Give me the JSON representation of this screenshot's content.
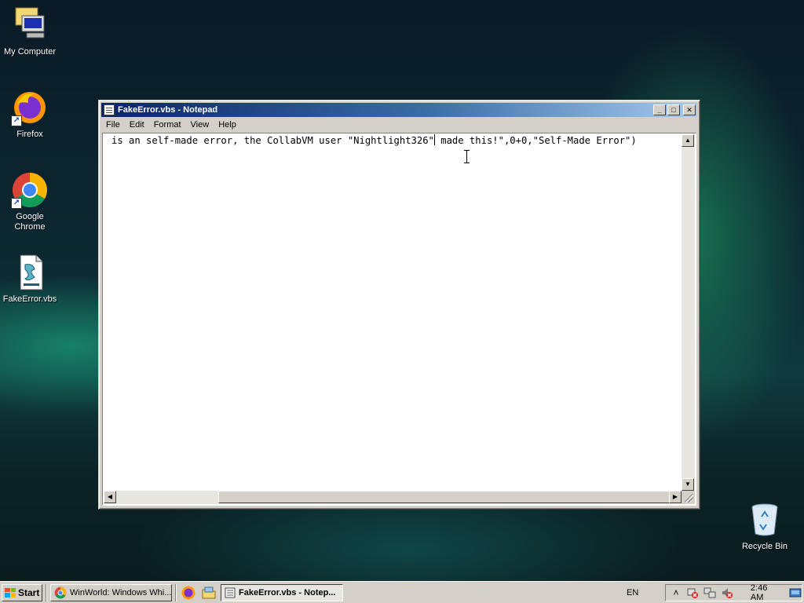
{
  "desktop": {
    "icons": [
      {
        "label": "My Computer",
        "icon": "my-computer-icon"
      },
      {
        "label": "Firefox",
        "icon": "firefox-icon"
      },
      {
        "label": "Google Chrome",
        "icon": "chrome-icon"
      },
      {
        "label": "FakeError.vbs",
        "icon": "vbs-script-icon"
      },
      {
        "label": "Recycle Bin",
        "icon": "recycle-bin-icon"
      }
    ]
  },
  "notepad": {
    "title": "FakeError.vbs - Notepad",
    "menu": [
      "File",
      "Edit",
      "Format",
      "View",
      "Help"
    ],
    "text_before_caret": "is an self-made error, the CollabVM user \"Nightlight326\"",
    "text_after_caret": " made this!\",0+0,\"Self-Made Error\")",
    "controls": {
      "minimize": "0",
      "maximize": "1",
      "close": "r"
    }
  },
  "taskbar": {
    "start_label": "Start",
    "buttons": [
      {
        "label": "WinWorld: Windows Whi...",
        "icon": "chrome-icon"
      },
      {
        "label": "FakeError.vbs - Notep...",
        "icon": "notepad-icon",
        "active": true
      }
    ],
    "quick_launch": [
      "firefox-icon",
      "file-manager-icon"
    ],
    "language": "EN",
    "tray_icons": [
      "show-hidden-icon",
      "network-error-icon",
      "network-icon",
      "volume-muted-icon"
    ],
    "clock": "2:46 AM"
  },
  "colors": {
    "title_active_start": "#0a246a",
    "title_active_end": "#a6caf0",
    "face": "#d4d0c8"
  }
}
